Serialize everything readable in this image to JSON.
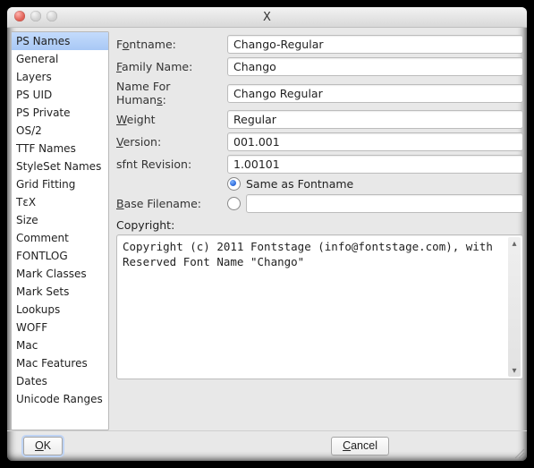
{
  "window": {
    "title": "X"
  },
  "sidebar": {
    "selected": 0,
    "items": [
      "PS Names",
      "General",
      "Layers",
      "PS UID",
      "PS Private",
      "OS/2",
      "TTF Names",
      "StyleSet Names",
      "Grid Fitting",
      "TεX",
      "Size",
      "Comment",
      "FONTLOG",
      "Mark Classes",
      "Mark Sets",
      "Lookups",
      "WOFF",
      "Mac",
      "Mac Features",
      "Dates",
      "Unicode Ranges"
    ]
  },
  "form": {
    "fontname_label": "Fontname:",
    "fontname": "Chango-Regular",
    "family_label": "Family Name:",
    "family": "Chango",
    "humans_label": "Name For Humans:",
    "humans": "Chango Regular",
    "weight_label": "Weight",
    "weight": "Regular",
    "version_label": "Version:",
    "version": "001.001",
    "sfnt_label": "sfnt Revision:",
    "sfnt": "1.00101",
    "basefile_label": "Base Filename:",
    "same_as_fontname": "Same as Fontname",
    "base_filename": "",
    "copyright_label": "Copyright:",
    "copyright": "Copyright (c) 2011 Fontstage (info@fontstage.com), with Reserved Font Name \"Chango\""
  },
  "buttons": {
    "ok": "OK",
    "cancel": "Cancel"
  }
}
